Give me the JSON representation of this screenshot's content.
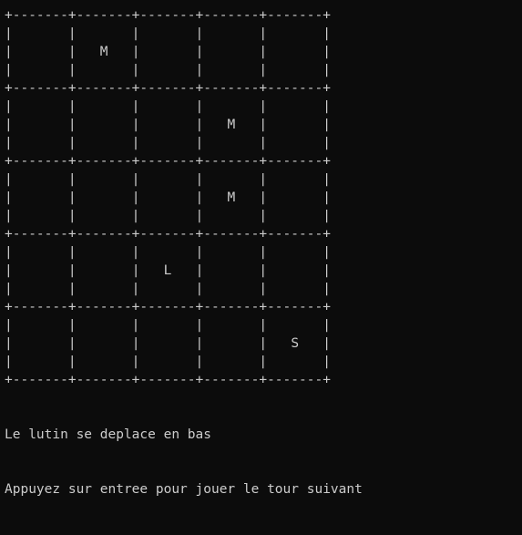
{
  "terminal": {
    "background": "#0c0c0c",
    "foreground": "#cccccc"
  },
  "board": {
    "rows": 5,
    "cols": 5,
    "cells": [
      [
        "",
        "M",
        "",
        "",
        ""
      ],
      [
        "",
        "",
        "",
        "M",
        ""
      ],
      [
        "",
        "",
        "",
        "M",
        ""
      ],
      [
        "",
        "",
        "L",
        "",
        ""
      ],
      [
        "",
        "",
        "",
        "",
        "S"
      ]
    ]
  },
  "messages": {
    "line1": "Le lutin se deplace en bas",
    "line2": "Appuyez sur entree pour jouer le tour suivant"
  }
}
